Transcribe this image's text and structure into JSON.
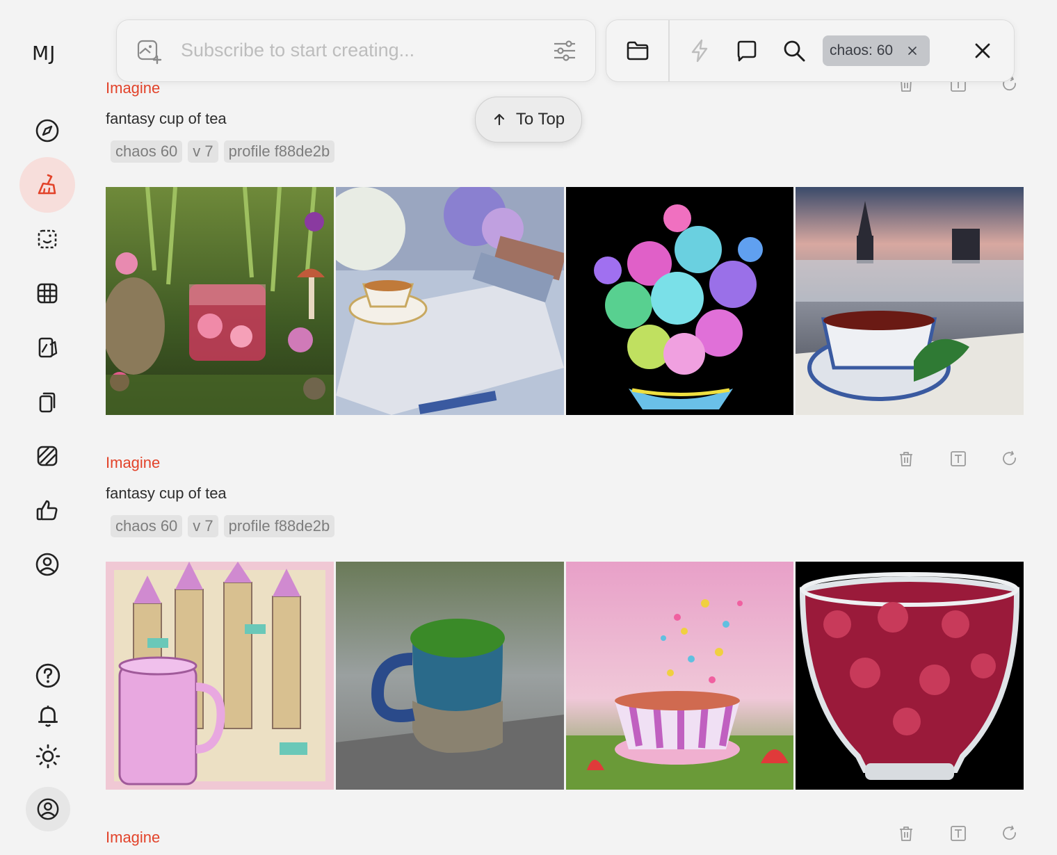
{
  "logo": "MJ",
  "prompt_bar": {
    "placeholder": "Subscribe to start creating..."
  },
  "filter_chip": {
    "label": "chaos: 60"
  },
  "to_top": {
    "label": "To Top"
  },
  "jobs": [
    {
      "kind": "Imagine",
      "prompt": "fantasy cup of tea",
      "tags": [
        "chaos 60",
        "v 7",
        "profile f88de2b"
      ]
    },
    {
      "kind": "Imagine",
      "prompt": "fantasy cup of tea",
      "tags": [
        "chaos 60",
        "v 7",
        "profile f88de2b"
      ]
    },
    {
      "kind": "Imagine"
    }
  ],
  "images": [
    [
      "fairy tea glass cup among flowers and mushrooms",
      "teacup on table with books and flowers",
      "rainbow succulent bouquet in bowl",
      "teacup with mint over foggy city"
    ],
    [
      "pink mug in front of fantasy castle",
      "tiny ceramic mug with moss",
      "striped teacup in candy blossom garden",
      "glass bowl with red leaves"
    ]
  ],
  "colors": {
    "accent": "#e2432a",
    "active_bg": "#f7dedb",
    "chip_bg": "#c4c6ca"
  }
}
